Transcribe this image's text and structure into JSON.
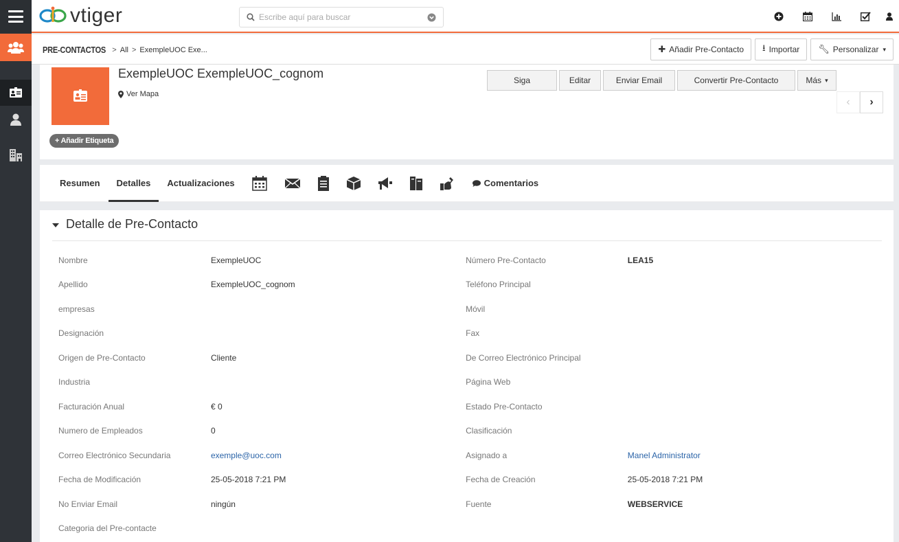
{
  "app": {
    "logo_text": "vtiger",
    "accent": "#f26b3a"
  },
  "search": {
    "placeholder": "Escribe aquí para buscar"
  },
  "breadcrumb": {
    "module": "PRE-CONTACTOS",
    "filter": "All",
    "record": "ExempleUOC Exe..."
  },
  "header_actions": {
    "add": "Añadir Pre-Contacto",
    "import": "Importar",
    "customize": "Personalizar"
  },
  "record": {
    "name": "ExempleUOC ExempleUOC_cognom",
    "map_link": "Ver Mapa",
    "tag_button": "+ Añadir Etiqueta",
    "actions": {
      "follow": "Siga",
      "edit": "Editar",
      "send_email": "Enviar Email",
      "convert": "Convertir Pre-Contacto",
      "more": "Más"
    }
  },
  "tabs": {
    "summary": "Resumen",
    "details": "Detalles",
    "updates": "Actualizaciones",
    "comments": "Comentarios"
  },
  "section": {
    "title": "Detalle de Pre-Contacto"
  },
  "fields": {
    "r1": {
      "l1": "Nombre",
      "v1": "ExempleUOC",
      "l2": "Número Pre-Contacto",
      "v2": "LEA15"
    },
    "r2": {
      "l1": "Apellido",
      "v1": "ExempleUOC_cognom",
      "l2": "Teléfono Principal",
      "v2": ""
    },
    "r3": {
      "l1": "empresas",
      "v1": "",
      "l2": "Móvil",
      "v2": ""
    },
    "r4": {
      "l1": "Designación",
      "v1": "",
      "l2": "Fax",
      "v2": ""
    },
    "r5": {
      "l1": "Origen de Pre-Contacto",
      "v1": "Cliente",
      "l2": "De Correo Electrónico Principal",
      "v2": ""
    },
    "r6": {
      "l1": "Industria",
      "v1": "",
      "l2": "Página Web",
      "v2": ""
    },
    "r7": {
      "l1": "Facturación Anual",
      "v1": "€ 0",
      "l2": "Estado Pre-Contacto",
      "v2": ""
    },
    "r8": {
      "l1": "Numero de Empleados",
      "v1": "0",
      "l2": "Clasificación",
      "v2": ""
    },
    "r9": {
      "l1": "Correo Electrónico Secundaria",
      "v1": "exemple@uoc.com",
      "l2": "Asignado a",
      "v2": "Manel Administrator"
    },
    "r10": {
      "l1": "Fecha de Modificación",
      "v1": "25-05-2018 7:21 PM",
      "l2": "Fecha de Creación",
      "v2": "25-05-2018 7:21 PM"
    },
    "r11": {
      "l1": "No Enviar Email",
      "v1": "ningún",
      "l2": "Fuente",
      "v2": "WEBSERVICE"
    },
    "r12": {
      "l1": "Categoria del Pre-contacte",
      "v1": "",
      "l2": "",
      "v2": ""
    }
  }
}
